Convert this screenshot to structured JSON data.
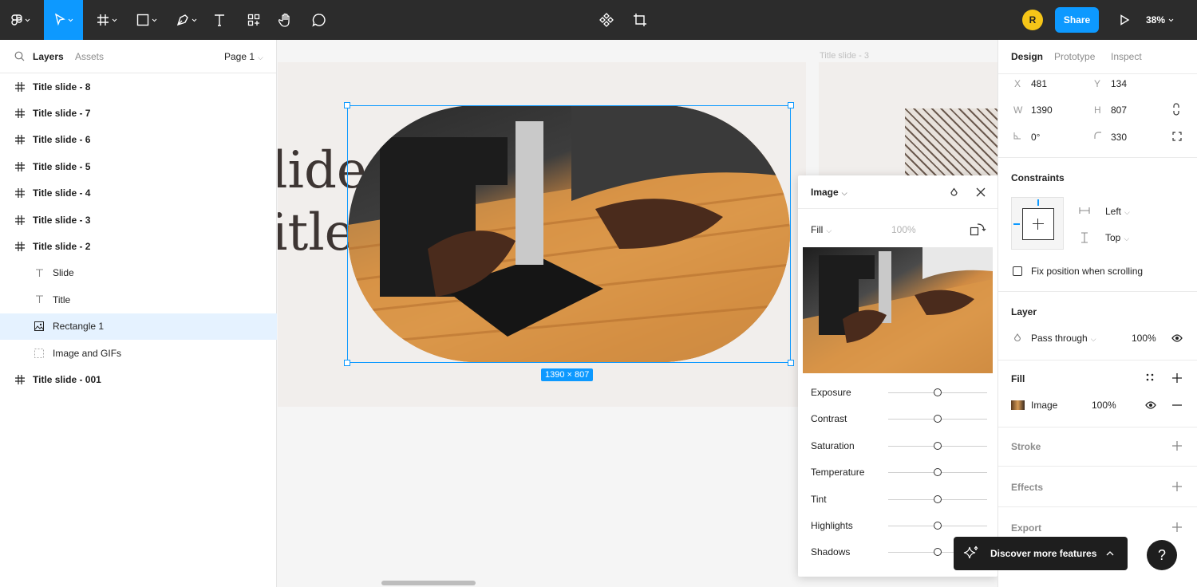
{
  "toolbar": {
    "zoom": "38%",
    "share_label": "Share",
    "avatar_initial": "R",
    "accent": "#0d99ff"
  },
  "left_panel": {
    "tabs": [
      "Layers",
      "Assets"
    ],
    "page": "Page 1",
    "layers": [
      {
        "label": "Title slide - 8",
        "type": "frame"
      },
      {
        "label": "Title slide - 7",
        "type": "frame"
      },
      {
        "label": "Title slide - 6",
        "type": "frame"
      },
      {
        "label": "Title slide - 5",
        "type": "frame"
      },
      {
        "label": "Title slide - 4",
        "type": "frame"
      },
      {
        "label": "Title slide - 3",
        "type": "frame"
      },
      {
        "label": "Title slide - 2",
        "type": "frame"
      },
      {
        "label": "Slide",
        "type": "text"
      },
      {
        "label": "Title",
        "type": "text"
      },
      {
        "label": "Rectangle 1",
        "type": "image",
        "selected": true
      },
      {
        "label": "Image and GIFs",
        "type": "group"
      },
      {
        "label": "Title slide - 001",
        "type": "frame"
      }
    ]
  },
  "canvas": {
    "frame_label": "Title slide - 3",
    "slide_word_1": "lide",
    "slide_word_2": "itle",
    "dimension_badge": "1390 × 807"
  },
  "image_popover": {
    "title": "Image",
    "fill_mode": "Fill",
    "opacity": "100%",
    "adjustments": [
      {
        "label": "Exposure",
        "value": 0.5
      },
      {
        "label": "Contrast",
        "value": 0.5
      },
      {
        "label": "Saturation",
        "value": 0.5
      },
      {
        "label": "Temperature",
        "value": 0.5
      },
      {
        "label": "Tint",
        "value": 0.5
      },
      {
        "label": "Highlights",
        "value": 0.5
      },
      {
        "label": "Shadows",
        "value": 0.5
      }
    ]
  },
  "right_panel": {
    "tabs": [
      "Design",
      "Prototype",
      "Inspect"
    ],
    "x_label": "X",
    "x": "481",
    "y_label": "Y",
    "y": "134",
    "w_label": "W",
    "w": "1390",
    "h_label": "H",
    "h": "807",
    "rotation": "0°",
    "radius": "330",
    "constraints_title": "Constraints",
    "horizontal": "Left",
    "vertical": "Top",
    "fix_position": "Fix position when scrolling",
    "layer_title": "Layer",
    "blend": "Pass through",
    "layer_opacity": "100%",
    "fill_title": "Fill",
    "fill_type": "Image",
    "fill_opacity": "100%",
    "stroke_title": "Stroke",
    "effects_title": "Effects",
    "export_title": "Export"
  },
  "toast": {
    "text": "Discover more features"
  },
  "help": "?"
}
